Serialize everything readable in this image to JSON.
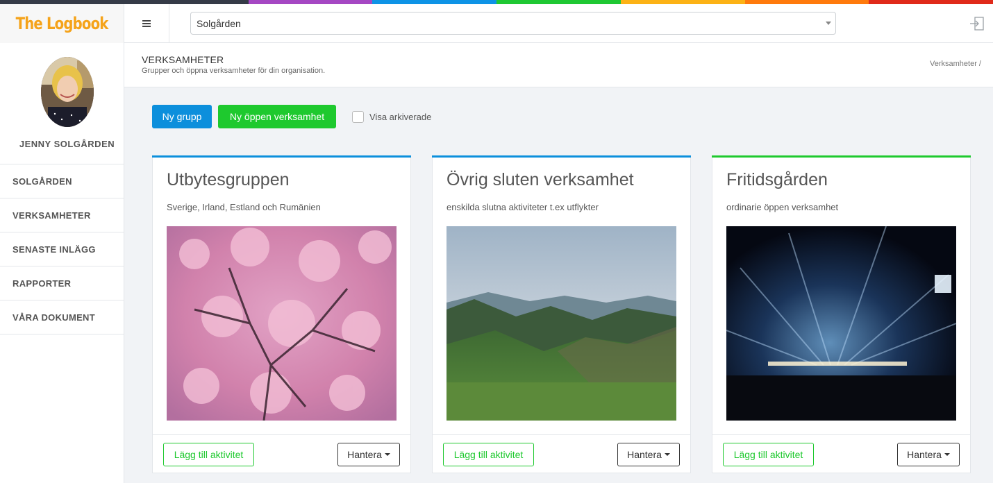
{
  "brand": {
    "logo_text": "The Logbook",
    "logo_color": "#f5a31a"
  },
  "rainbow_colors": [
    "#353b47",
    "#353b47",
    "#a547c3",
    "#0e93e6",
    "#1fc833",
    "#fcb216",
    "#ff7a0c",
    "#e02a1a"
  ],
  "header": {
    "org_selected": "Solgården"
  },
  "user": {
    "name": "JENNY SOLGÅRDEN"
  },
  "nav": {
    "items": [
      {
        "label": "SOLGÅRDEN"
      },
      {
        "label": "VERKSAMHETER"
      },
      {
        "label": "SENASTE INLÄGG"
      },
      {
        "label": "RAPPORTER"
      },
      {
        "label": "VÅRA DOKUMENT"
      }
    ]
  },
  "page": {
    "title": "VERKSAMHETER",
    "subtitle": "Grupper och öppna verksamheter för din organisation.",
    "breadcrumb": "Verksamheter /"
  },
  "toolbar": {
    "new_group": "Ny grupp",
    "new_open": "Ny öppen verksamhet",
    "show_archived": "Visa arkiverade"
  },
  "cards": [
    {
      "title": "Utbytesgruppen",
      "description": "Sverige, Irland, Estland och Rumänien",
      "image": "cherry-blossom",
      "accent": "#0c8fdc",
      "add_label": "Lägg till aktivitet",
      "manage_label": "Hantera"
    },
    {
      "title": "Övrig sluten verksamhet",
      "description": "enskilda slutna aktiviteter t.ex utflykter",
      "image": "green-mountains",
      "accent": "#0c8fdc",
      "add_label": "Lägg till aktivitet",
      "manage_label": "Hantera"
    },
    {
      "title": "Fritidsgården",
      "description": "ordinarie öppen verksamhet",
      "image": "concert-lights",
      "accent": "#1ec92e",
      "add_label": "Lägg till aktivitet",
      "manage_label": "Hantera"
    }
  ],
  "colors": {
    "primary": "#0c8fdc",
    "success": "#1ec92e"
  }
}
